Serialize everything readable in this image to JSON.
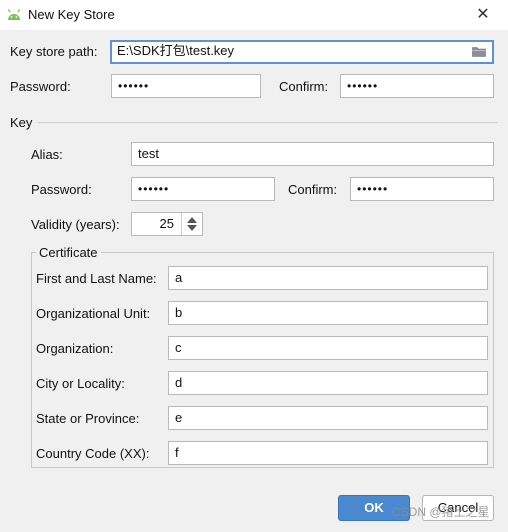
{
  "window": {
    "title": "New Key Store",
    "app_icon": "android-icon",
    "close_glyph": "✕"
  },
  "keystore": {
    "path_label": "Key store path:",
    "path_value": "E:\\SDK打包\\test.key",
    "browse_icon": "folder-icon",
    "password_label": "Password:",
    "password_value": "••••••",
    "confirm_label": "Confirm:",
    "confirm_value": "••••••"
  },
  "key": {
    "section_label": "Key",
    "alias_label": "Alias:",
    "alias_value": "test",
    "password_label": "Password:",
    "password_value": "••••••",
    "confirm_label": "Confirm:",
    "confirm_value": "••••••",
    "validity_label": "Validity (years):",
    "validity_value": "25"
  },
  "certificate": {
    "legend": "Certificate",
    "fields": [
      {
        "label": "First and Last Name:",
        "value": "a"
      },
      {
        "label": "Organizational Unit:",
        "value": "b"
      },
      {
        "label": "Organization:",
        "value": "c"
      },
      {
        "label": "City or Locality:",
        "value": "d"
      },
      {
        "label": "State or Province:",
        "value": "e"
      },
      {
        "label": "Country Code (XX):",
        "value": "f"
      }
    ]
  },
  "buttons": {
    "ok": "OK",
    "cancel": "Cancel"
  },
  "watermark": "CSDN @猪土之星",
  "colors": {
    "accent": "#4a88cf",
    "android_green": "#78c257",
    "folder": "#8a8f96"
  }
}
